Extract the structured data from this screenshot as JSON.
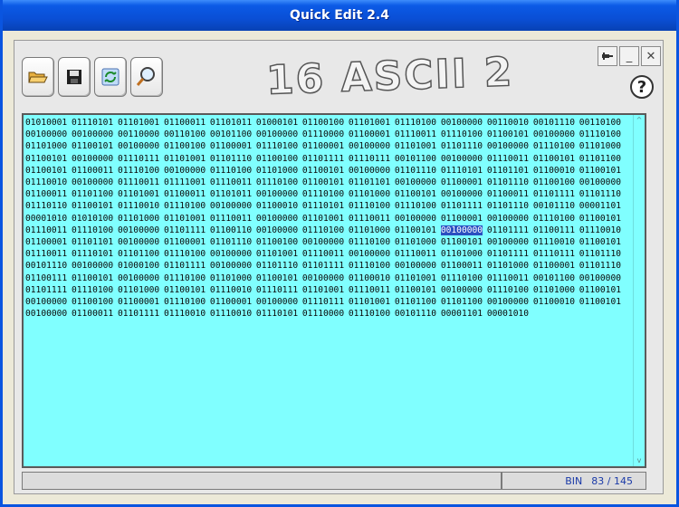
{
  "window": {
    "title": "Quick Edit 2.4"
  },
  "toolbar": {
    "buttons": [
      {
        "name": "open",
        "icon": "folder-open-icon"
      },
      {
        "name": "save",
        "icon": "floppy-disk-icon"
      },
      {
        "name": "convert",
        "icon": "refresh-icon"
      },
      {
        "name": "find",
        "icon": "magnifier-icon"
      }
    ]
  },
  "logo": {
    "text": "16 ASCII 2"
  },
  "window_controls": {
    "pin": "⚲",
    "minimize": "_",
    "close": "✕"
  },
  "help": {
    "label": "?"
  },
  "editor": {
    "text_before": "01010001 01110101 01101001 01100011 01101011 01000101 01100100 01101001 01110100 00100000 00110010 00101110 00110100 00100000 00100000 00110000 00110100 00101100 00100000 01110000 01100001 01110011 01110100 01100101 00100000 01110100 01101000 01100101 00100000 01100100 01100001 01110100 01100001 00100000 01101001 01101110 00100000 01110100 01101000 01100101 00100000 01110111 01101001 01101110 01100100 01101111 01110111 00101100 00100000 01110011 01100101 01101100 01100101 01100011 01110100 00100000 01110100 01101000 01100101 00100000 01101110 01110101 01101101 01100010 01100101 01110010 00100000 01110011 01111001 01110011 01110100 01100101 01101101 00100000 01100001 01101110 01100100 00100000 01100011 01101100 01101001 01100011 01101011 00100000 01110100 01101000 01100101 00100000 01100011 01101111 01101110 01110110 01100101 01110010 01110100 00100000 01100010 01110101 01110100 01110100 01101111 01101110 00101110 00001101 00001010 01010100 01101000 01101001 01110011 00100000 01101001 01110011 00100000 01100001 00100000 01110100 01100101 01110011 01110100 00100000 01101111 01100110 00100000 01110100 01101000 01100101",
    "selected": "00100000",
    "text_after": "01101111 01100111 01110010 01100001 01101101 00100000 01100001 01101110 01100100 00100000 01110100 01101000 01100101 00100000 01110010 01100101 01110011 01110101 01101100 01110100 00100000 01101001 01110011 00100000 01110011 01101000 01101111 01110111 01101110 00101110 00100000 01000100 01101111 00100000 01101110 01101111 01110100 00100000 01100011 01101000 01100001 01101110 01100111 01100101 00100000 01110100 01101000 01100101 00100000 01100010 01101001 01110100 01110011 00101100 00100000 01101111 01110100 01101000 01100101 01110010 01110111 01101001 01110011 01100101 00100000 01110100 01101000 01100101 00100000 01100100 01100001 01110100 01100001 00100000 01110111 01101001 01101100 01101100 00100000 01100010 01100101 00100000 01100011 01101111 01110010 01110010 01110101 01110000 01110100 00101110 00001101 00001010",
    "background": "#80ffff"
  },
  "status": {
    "mode": "BIN",
    "position": "83 / 145"
  }
}
